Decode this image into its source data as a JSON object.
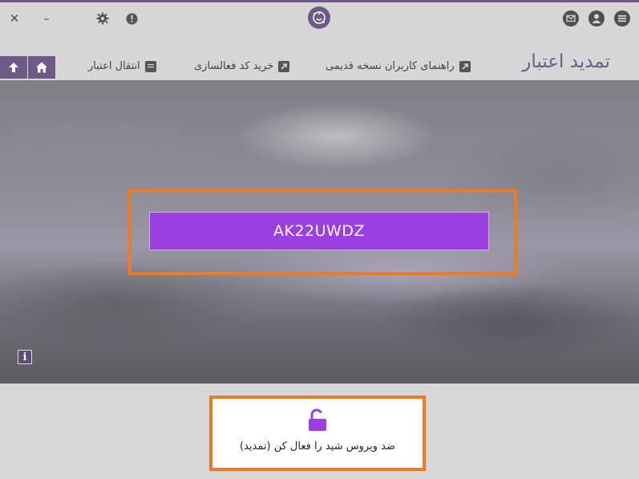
{
  "window": {
    "close_glyph": "✕",
    "minimize_glyph": "–",
    "settings_icon": "gear-icon",
    "alert_icon": "exclamation-icon",
    "logo_icon": "app-logo-icon",
    "mail_icon": "mail-icon",
    "user_icon": "user-icon",
    "menu_icon": "menu-icon"
  },
  "nav": {
    "title": "تمدید اعتبار",
    "links": [
      {
        "label": "راهنمای کاربران نسخه قدیمی",
        "icon": "external-link-icon"
      },
      {
        "label": "خرید کد فعالسازی",
        "icon": "external-link-icon"
      },
      {
        "label": "انتقال اعتبار",
        "icon": "transfer-icon"
      }
    ],
    "home_icon": "home-icon",
    "up_icon": "arrow-up-icon"
  },
  "main": {
    "code_value": "AK22UWDZ",
    "info_glyph": "i"
  },
  "activate": {
    "icon": "unlock-icon",
    "label": "ضد ویروس شید را فعال کن (تمدید)"
  },
  "colors": {
    "accent": "#6e5a86",
    "code_bg": "#9a3fe0",
    "highlight": "#f07a22"
  }
}
